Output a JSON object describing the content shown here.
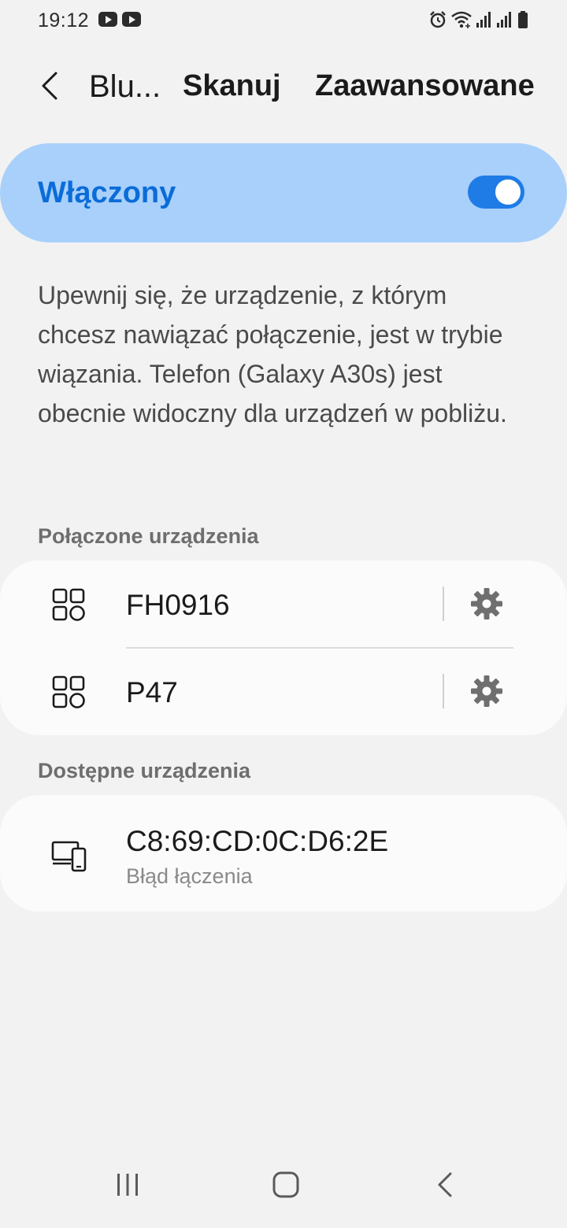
{
  "status_bar": {
    "time": "19:12",
    "notification_icons": [
      "youtube-icon",
      "youtube-icon"
    ],
    "system_icons": [
      "alarm-icon",
      "wifi-icon",
      "signal-icon",
      "signal-icon",
      "battery-icon"
    ]
  },
  "header": {
    "back_icon": "chevron-left-icon",
    "title": "Blu...",
    "scan_label": "Skanuj",
    "advanced_label": "Zaawansowane"
  },
  "bluetooth_toggle": {
    "label": "Włączony",
    "state": "on"
  },
  "description": "Upewnij się, że urządzenie, z którym chcesz nawiązać połączenie, jest w trybie wiązania. Telefon (Galaxy A30s) jest obecnie widoczny dla urządzeń w pobliżu.",
  "connected_section": {
    "title": "Połączone urządzenia",
    "devices": [
      {
        "name": "FH0916",
        "icon": "apps-icon"
      },
      {
        "name": "P47",
        "icon": "apps-icon"
      }
    ]
  },
  "available_section": {
    "title": "Dostępne urządzenia",
    "devices": [
      {
        "name": "C8:69:CD:0C:D6:2E",
        "status": "Błąd łączenia",
        "icon": "devices-icon"
      }
    ]
  },
  "colors": {
    "background": "#f2f2f2",
    "toggle_card": "#a8d0fb",
    "accent": "#0b6cd8",
    "switch": "#1f7be6",
    "card": "#fbfbfb"
  },
  "nav_bar": {
    "icons": [
      "recent-apps-icon",
      "home-icon",
      "back-icon"
    ]
  }
}
